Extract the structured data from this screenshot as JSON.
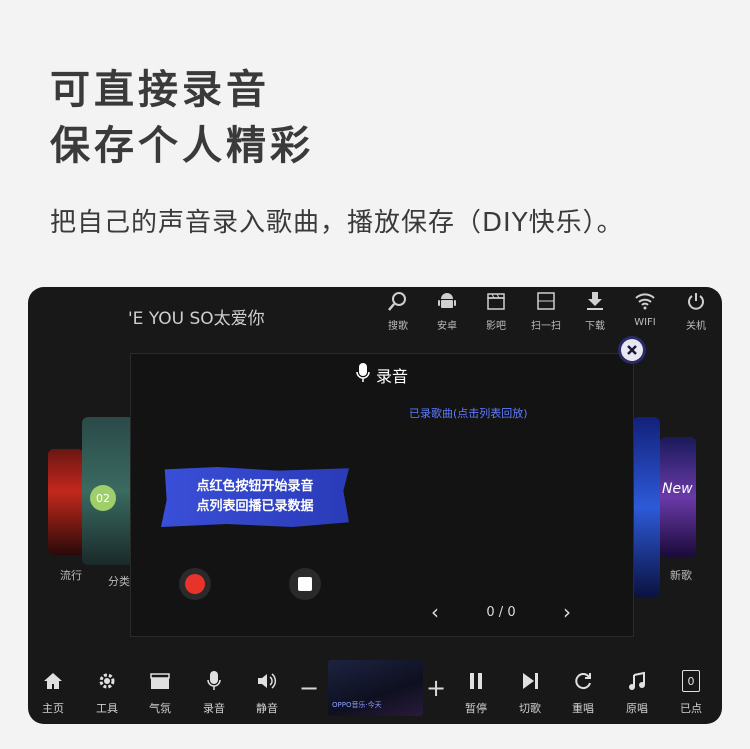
{
  "headline": {
    "line1": "可直接录音",
    "line2": "保存个人精彩"
  },
  "subline": "把自己的声音录入歌曲，播放保存（DIY快乐）。",
  "screen": {
    "marquee": "'E YOU SO太爱你",
    "top_nav": [
      {
        "icon": "search-icon",
        "label": "搜歌"
      },
      {
        "icon": "android-icon",
        "label": "安卓"
      },
      {
        "icon": "clapper-icon",
        "label": "影吧"
      },
      {
        "icon": "scan-icon",
        "label": "扫一扫"
      },
      {
        "icon": "download-icon",
        "label": "下载"
      },
      {
        "icon": "wifi-icon",
        "label": "WIFI"
      },
      {
        "icon": "power-icon",
        "label": "关机"
      }
    ],
    "side_labels": {
      "left1": "流行",
      "left2": "分类",
      "right1": "新歌"
    },
    "dialog": {
      "title": "录音",
      "recorded_label": "已录歌曲(点击列表回放)",
      "banner_line1": "点红色按钮开始录音",
      "banner_line2": "点列表回播已录数据",
      "pager": "0 / 0"
    },
    "thumbnail_caption": "OPPO音乐·今天",
    "bottom_nav_left": [
      {
        "icon": "home-icon",
        "label": "主页"
      },
      {
        "icon": "gear-icon",
        "label": "工具"
      },
      {
        "icon": "atmosphere-icon",
        "label": "气氛"
      },
      {
        "icon": "mic-icon",
        "label": "录音"
      },
      {
        "icon": "speaker-icon",
        "label": "静音"
      }
    ],
    "bottom_nav_right": [
      {
        "icon": "pause-icon",
        "label": "暂停"
      },
      {
        "icon": "skip-icon",
        "label": "切歌"
      },
      {
        "icon": "replay-icon",
        "label": "重唱"
      },
      {
        "icon": "note-icon",
        "label": "原唱"
      },
      {
        "icon": "queue-count-icon",
        "label": "已点",
        "count": "0"
      }
    ],
    "colors": {
      "record_red": "#e8332b",
      "banner_blue": "#3a4fd8",
      "link_blue": "#5f7bff"
    }
  }
}
